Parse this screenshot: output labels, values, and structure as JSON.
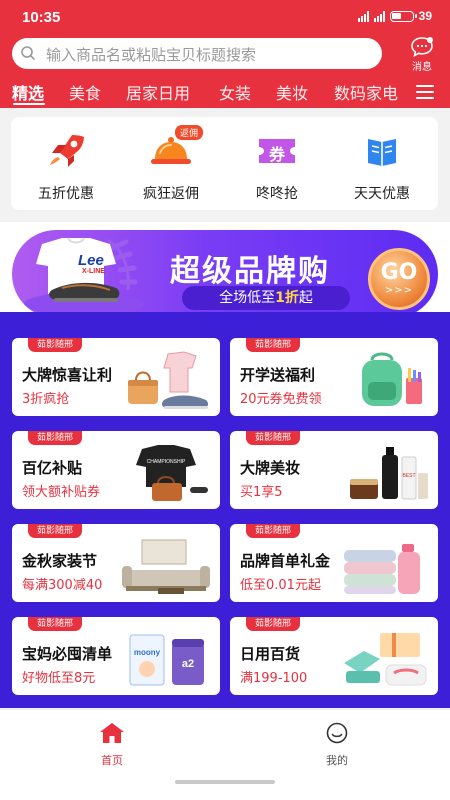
{
  "status": {
    "time": "10:35",
    "battery": "39"
  },
  "search": {
    "placeholder": "输入商品名或粘贴宝贝标题搜索"
  },
  "messages": {
    "label": "消息"
  },
  "categories": {
    "items": [
      "精选",
      "美食",
      "居家日用",
      "女装",
      "美妆",
      "数码家电"
    ],
    "active": "精选"
  },
  "quick_actions": [
    {
      "label": "五折优惠",
      "icon": "rocket-icon"
    },
    {
      "label": "疯狂返佣",
      "icon": "serving-dome-icon",
      "badge": "返佣"
    },
    {
      "label": "咚咚抢",
      "icon": "coupon-ticket-icon",
      "ticket_char": "券"
    },
    {
      "label": "天天优惠",
      "icon": "open-book-icon"
    }
  ],
  "banner": {
    "title": "超级品牌购",
    "subtitle_pre": "全场低至",
    "subtitle_hl": "1折",
    "subtitle_post": "起",
    "go": "GO",
    "go_arrows": ">>>",
    "shirt_brand": "Lee",
    "shirt_sub": "X-LINE"
  },
  "promos": [
    {
      "tag": "茹影随邢",
      "title": "大牌惊喜让利",
      "subtitle": "3折疯抢",
      "art": "handbag-sneaker-icon"
    },
    {
      "tag": "茹影随邢",
      "title": "开学送福利",
      "subtitle": "20元券免费领",
      "art": "backpack-icon"
    },
    {
      "tag": "茹影随邢",
      "title": "百亿补贴",
      "subtitle": "领大额补贴券",
      "art": "tshirt-bag-icon",
      "tshirt_text": "CHAMPIONSHIP"
    },
    {
      "tag": "茹影随邢",
      "title": "大牌美妆",
      "subtitle": "买1享5",
      "art": "cosmetics-icon",
      "cosmetics_text": "BEST"
    },
    {
      "tag": "茹影随邢",
      "title": "金秋家装节",
      "subtitle": "每满300减40",
      "art": "sofa-icon"
    },
    {
      "tag": "茹影随邢",
      "title": "品牌首单礼金",
      "subtitle": "低至0.01元起",
      "art": "towels-bottle-icon"
    },
    {
      "tag": "茹影随邢",
      "title": "宝妈必囤清单",
      "subtitle": "好物低至8元",
      "art": "diapers-formula-icon",
      "diaper_brand": "moony",
      "formula_brand": "a2"
    },
    {
      "tag": "茹影随邢",
      "title": "日用百货",
      "subtitle": "满199-100",
      "art": "household-goods-icon"
    }
  ],
  "bottom_nav": [
    {
      "label": "首页",
      "icon": "home-icon",
      "active": true
    },
    {
      "label": "我的",
      "icon": "profile-icon",
      "active": false
    }
  ],
  "colors": {
    "brand_red": "#e8313f",
    "promo_bg": "#3c1fd6",
    "banner_purple": "#7a3df5"
  }
}
